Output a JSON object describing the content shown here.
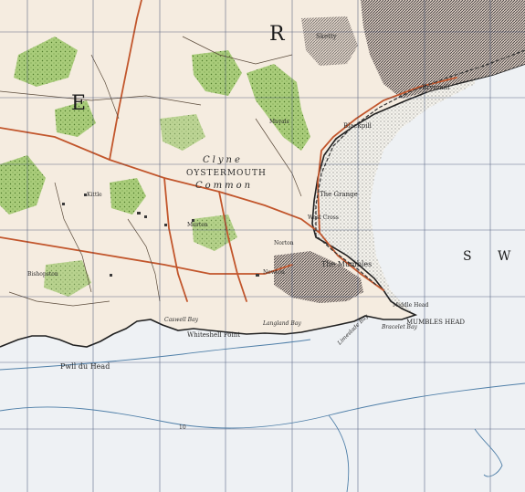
{
  "map": {
    "labels": {
      "oystermouth": "OYSTERMOUTH",
      "clyne": "Clyne",
      "common": "Common",
      "the_mumbles": "The Mumbles",
      "mumbles_head": "MUMBLES HEAD",
      "pwll_du_head": "Pwll du Head",
      "whiteshell_point": "Whiteshell Point",
      "bracelet_bay": "Bracelet Bay",
      "limeslade_bay": "Limeslade Bay",
      "langland_bay": "Langland Bay",
      "caswell_bay": "Caswell Bay",
      "the_grange": "The Grange",
      "west_cross": "West Cross",
      "blackpill": "Blackpill",
      "brynmill": "Brynmill",
      "middle_head": "Middle Head",
      "sketty": "Sketty",
      "kittle": "Kittle",
      "bishopston": "Bishopston",
      "murton": "Murton",
      "newton": "Newton",
      "norton": "Norton",
      "mayals": "Mayals",
      "sea_s": "S",
      "sea_w": "W",
      "letter_e": "E",
      "letter_r": "R",
      "contour_10": "10"
    }
  }
}
